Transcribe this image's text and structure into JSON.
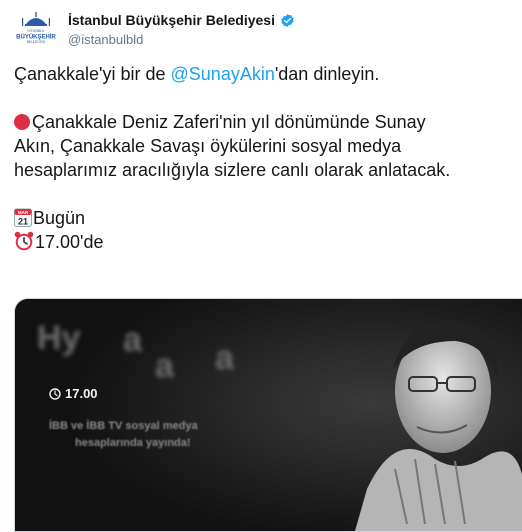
{
  "account": {
    "display_name": "İstanbul Büyükşehir Belediyesi",
    "handle": "@istanbulbld",
    "avatar_caption_top": "İSTANBUL",
    "avatar_caption_mid": "BÜYÜKŞEHİR",
    "avatar_caption_bottom": "BELEDİYESİ"
  },
  "tweet": {
    "line1_before": "Çanakkale'yi bir de ",
    "line1_mention": "@SunayAkin",
    "line1_after": "'dan dinleyin.",
    "para2_line1": "Çanakkale Deniz Zaferi'nin yıl dönümünde Sunay",
    "para2_line2": "Akın, Çanakkale Savaşı öykülerini sosyal medya",
    "para2_line3": "hesaplarımız aracılığıyla sizlere canlı olarak anlatacak.",
    "date_label": "Bugün",
    "time_label": "17.00'de",
    "calendar_month": "MAR",
    "calendar_day": "21"
  },
  "media": {
    "time": "17.00",
    "faded_line1": "İBB ve İBB TV sosyal medya",
    "faded_line2": "hesaplarında yayında!",
    "faded_big1": "Hy",
    "faded_big2": "a",
    "faded_big3": "a",
    "faded_big4": "a"
  },
  "colors": {
    "mention": "#1da1f2",
    "verified": "#1da1f2",
    "logo_blue": "#2b5ca8",
    "red_circle": "#dd2e44"
  },
  "icons": [
    "verified-badge-icon",
    "red-circle-icon",
    "calendar-icon",
    "alarm-clock-icon",
    "clock-icon"
  ]
}
